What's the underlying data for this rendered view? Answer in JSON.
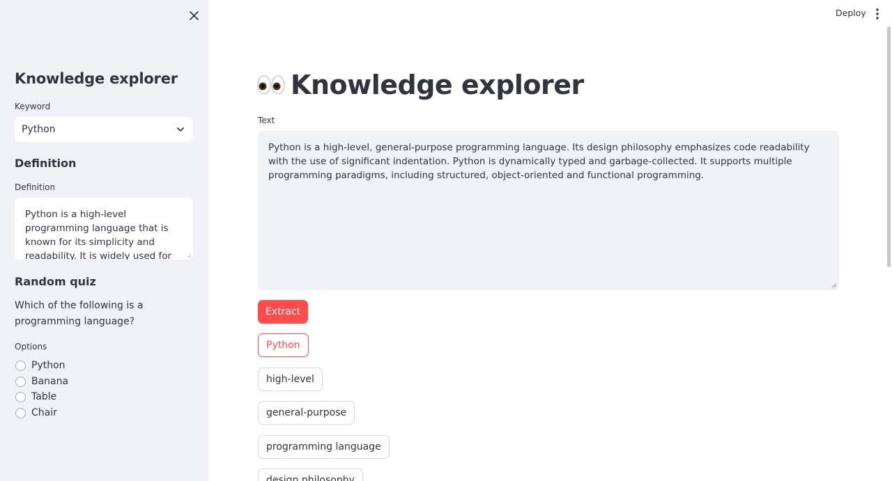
{
  "sidebar": {
    "title": "Knowledge explorer",
    "keyword_label": "Keyword",
    "keyword_value": "Python",
    "definition_heading": "Definition",
    "definition_label": "Definition",
    "definition_text": "Python is a high-level programming language that is known for its simplicity and readability. It is widely used for various purposes such as",
    "quiz_heading": "Random quiz",
    "quiz_question": "Which of the following is a programming language?",
    "options_label": "Options",
    "options": [
      "Python",
      "Banana",
      "Table",
      "Chair"
    ]
  },
  "header": {
    "deploy_label": "Deploy"
  },
  "main": {
    "title": "Knowledge explorer",
    "text_label": "Text",
    "text_value": "Python is a high-level, general-purpose programming language. Its design philosophy emphasizes code readability with the use of significant indentation. Python is dynamically typed and garbage-collected. It supports multiple programming paradigms, including structured, object-oriented and functional programming.",
    "extract_label": "Extract",
    "keywords": [
      "Python",
      "high-level",
      "general-purpose",
      "programming language",
      "design philosophy"
    ]
  },
  "colors": {
    "primary": "#ff4b4b",
    "sidebar_bg": "#f0f2f6",
    "text": "#31333f"
  }
}
